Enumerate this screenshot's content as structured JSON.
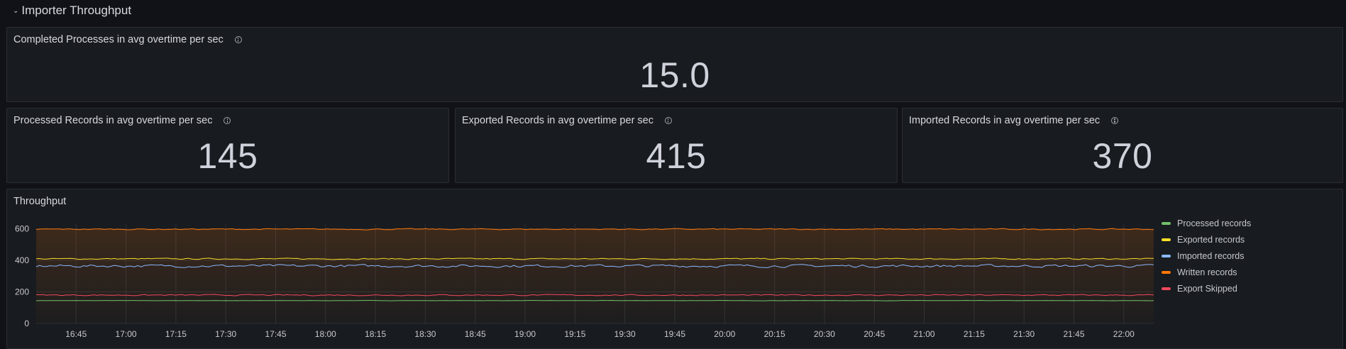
{
  "row": {
    "title": "Importer Throughput",
    "chevron": "⌄"
  },
  "stats": [
    {
      "title": "Completed Processes in avg overtime per sec",
      "value": "15.0"
    },
    {
      "title": "Processed Records in avg overtime per sec",
      "value": "145"
    },
    {
      "title": "Exported Records in avg overtime per sec",
      "value": "415"
    },
    {
      "title": "Imported Records in avg overtime per sec",
      "value": "370"
    }
  ],
  "throughput": {
    "title": "Throughput"
  },
  "chart_data": {
    "type": "line",
    "title": "Throughput",
    "x_tick_labels": [
      "16:45",
      "17:00",
      "17:15",
      "17:30",
      "17:45",
      "18:00",
      "18:15",
      "18:30",
      "18:45",
      "19:00",
      "19:15",
      "19:30",
      "19:45",
      "20:00",
      "20:15",
      "20:30",
      "20:45",
      "21:00",
      "21:15",
      "21:30",
      "21:45",
      "22:00"
    ],
    "y_tick_labels": [
      "0",
      "200",
      "400",
      "600"
    ],
    "ylim": [
      0,
      630
    ],
    "x_range": [
      "16:33",
      "22:09"
    ],
    "grid": true,
    "legend_position": "right",
    "series": [
      {
        "name": "Processed records",
        "color": "#73bf69",
        "level": 145,
        "noise": 1,
        "fill": false
      },
      {
        "name": "Exported records",
        "color": "#fade2a",
        "level": 410,
        "noise": 4,
        "fill": false
      },
      {
        "name": "Imported records",
        "color": "#8ab8ff",
        "level": 365,
        "noise": 9,
        "fill": false
      },
      {
        "name": "Written records",
        "color": "#ff780a",
        "level": 598,
        "noise": 4,
        "fill": true
      },
      {
        "name": "Export Skipped",
        "color": "#f2495c",
        "level": 180,
        "noise": 4,
        "fill": false
      }
    ]
  }
}
